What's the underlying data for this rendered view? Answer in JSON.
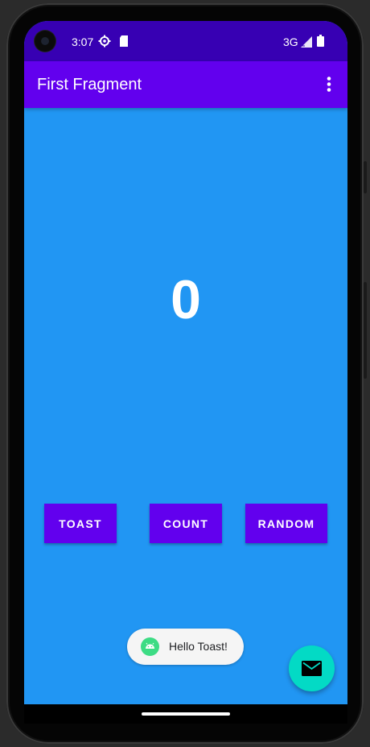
{
  "status_bar": {
    "time": "3:07",
    "network": "3G",
    "icons": [
      "settings-gear-icon",
      "sd-card-icon",
      "signal-icon",
      "battery-icon"
    ]
  },
  "app_bar": {
    "title": "First Fragment",
    "menu_icon": "more-vert-icon"
  },
  "main": {
    "counter_value": "0",
    "buttons": {
      "toast": "TOAST",
      "count": "COUNT",
      "random": "RANDOM"
    }
  },
  "toast": {
    "message": "Hello Toast!",
    "icon": "android-icon"
  },
  "fab": {
    "icon": "email-icon"
  },
  "colors": {
    "status_bar": "#3700B3",
    "primary": "#6200EE",
    "background": "#2196F3",
    "fab": "#03DAC5"
  }
}
